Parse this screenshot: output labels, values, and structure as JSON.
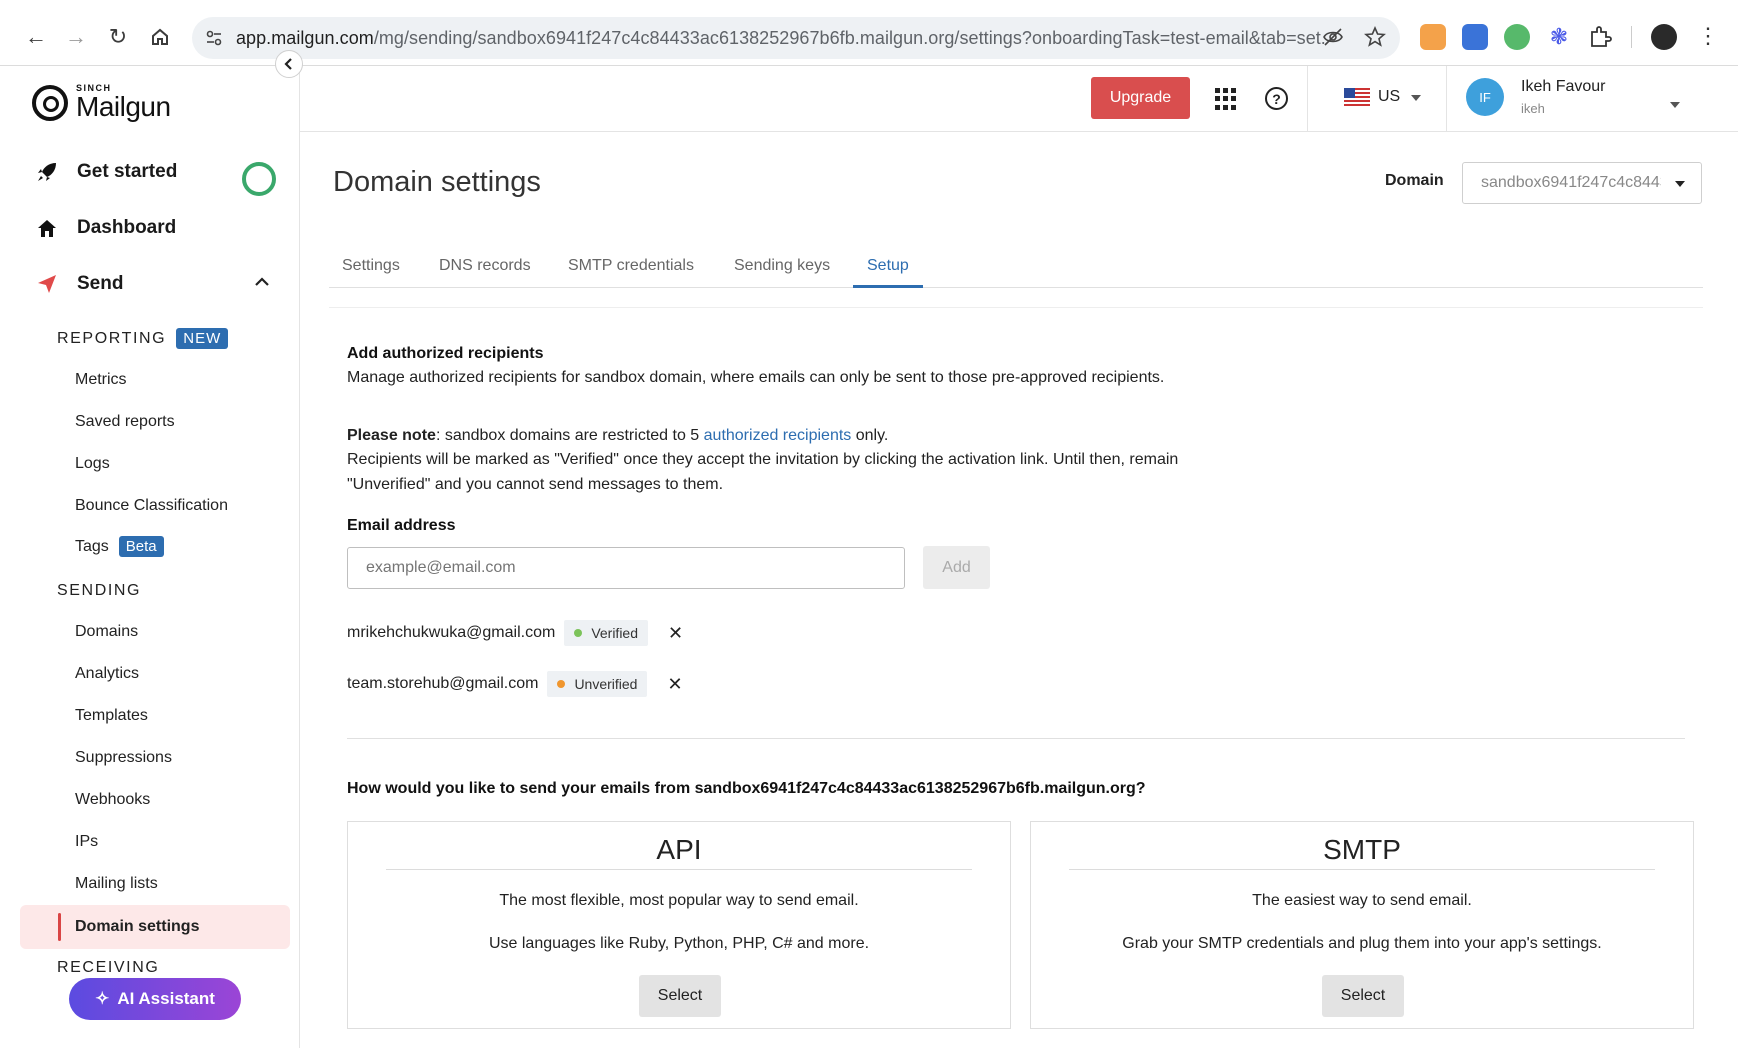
{
  "browser": {
    "url_host": "app.mailgun.com",
    "url_path": "/mg/sending/sandbox6941f247c4c84433ac6138252967b6fb.mailgun.org/settings?onboardingTask=test-email&tab=set..."
  },
  "brand": {
    "sinch": "SINCH",
    "name": "Mailgun"
  },
  "sidebar": {
    "main_items": [
      {
        "label": "Get started",
        "icon": "rocket-icon"
      },
      {
        "label": "Dashboard",
        "icon": "home-icon"
      },
      {
        "label": "Send",
        "icon": "send-icon"
      }
    ],
    "reporting_header": "REPORTING",
    "reporting_badge": "NEW",
    "reporting_items": [
      "Metrics",
      "Saved reports",
      "Logs",
      "Bounce Classification",
      "Tags"
    ],
    "tags_badge": "Beta",
    "sending_header": "SENDING",
    "sending_items": [
      "Domains",
      "Analytics",
      "Templates",
      "Suppressions",
      "Webhooks",
      "IPs",
      "Mailing lists",
      "Domain settings"
    ],
    "receiving_header": "RECEIVING",
    "ai_assistant": "AI Assistant"
  },
  "header": {
    "upgrade": "Upgrade",
    "region": "US",
    "user": {
      "initials": "IF",
      "name": "Ikeh Favour",
      "username": "ikeh"
    }
  },
  "main": {
    "title": "Domain settings",
    "domain_label": "Domain",
    "domain_value": "sandbox6941f247c4c84433ac6138252967b6fb.mailgun.org",
    "tabs": [
      "Settings",
      "DNS records",
      "SMTP credentials",
      "Sending keys",
      "Setup"
    ],
    "active_tab": "Setup",
    "recipients": {
      "heading": "Add authorized recipients",
      "description": "Manage authorized recipients for sandbox domain, where emails can only be sent to those pre-approved recipients.",
      "note_bold": "Please note",
      "note_text_1": ": sandbox domains are restricted to 5 ",
      "note_link": "authorized recipients",
      "note_text_2": " only.",
      "note_line2": "Recipients will be marked as \"Verified\" once they accept the invitation by clicking the activation link. Until then, remain",
      "note_line3": "\"Unverified\" and you cannot send messages to them.",
      "email_label": "Email address",
      "email_placeholder": "example@email.com",
      "add_button": "Add",
      "list": [
        {
          "email": "mrikehchukwuka@gmail.com",
          "status": "Verified",
          "color": "#7cc35a"
        },
        {
          "email": "team.storehub@gmail.com",
          "status": "Unverified",
          "color": "#f0962e"
        }
      ]
    },
    "send_question": "How would you like to send your emails from sandbox6941f247c4c84433ac6138252967b6fb.mailgun.org?",
    "options": [
      {
        "title": "API",
        "line1": "The most flexible, most popular way to send email.",
        "line2": "Use languages like Ruby, Python, PHP, C# and more.",
        "button": "Select"
      },
      {
        "title": "SMTP",
        "line1": "The easiest way to send email.",
        "line2": "Grab your SMTP credentials and plug them into your app's settings.",
        "button": "Select"
      }
    ]
  },
  "colors": {
    "accent": "#2d6db0",
    "upgrade": "#d94e4e",
    "active_bg": "#fde8e8",
    "ring": "#3aa86b"
  }
}
